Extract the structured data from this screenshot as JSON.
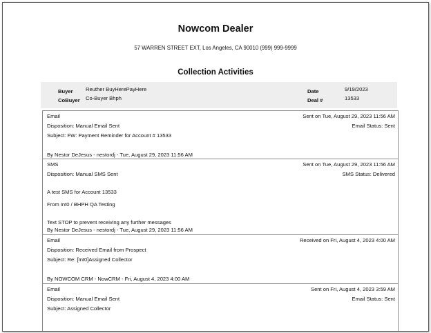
{
  "header": {
    "company_name": "Nowcom Dealer",
    "address": "57 WARREN STREET EXT, Los Angeles, CA 90010  (999) 999-9999",
    "report_title": "Collection Activities"
  },
  "summary": {
    "buyer_label": "Buyer",
    "buyer_value": "Reuther BuyHerePayHere",
    "cobuyer_label": "CoBuyer",
    "cobuyer_value": "Co-Buyer Bhph",
    "date_label": "Date",
    "date_value": "9/19/2023",
    "deal_label": "Deal #",
    "deal_value": "13533"
  },
  "activities": [
    {
      "type": "Email",
      "time": "Sent on Tue, August 29, 2023 11:56 AM",
      "disposition": "Disposition: Manual Email Sent",
      "status": "Email Status: Sent",
      "subject": "Subject: FW: Payment Reminder for Account # 13533",
      "by": "By Nestor DeJesus - nestordj - Tue, August 29, 2023 11:56 AM"
    },
    {
      "type": "SMS",
      "time": "Sent on Tue, August 29, 2023 11:56 AM",
      "disposition": "Disposition: Manual SMS Sent",
      "status": "SMS Status: Delivered",
      "body_1": "A test SMS for Account 13533",
      "body_2": "From Int0 / BHPH QA Testing",
      "body_3": "Text STOP to prevent receiving any further messages",
      "by": "By Nestor DeJesus - nestordj - Tue, August 29, 2023 11:56 AM"
    },
    {
      "type": "Email",
      "time": "Received on Fri, August 4, 2023 4:00 AM",
      "disposition": "Disposition: Received Email from Prospect",
      "subject": "Subject: Re: [Int0]Assigned Collector",
      "by": "By NOWCOM CRM - NowCRM - Fri, August 4, 2023 4:00 AM"
    },
    {
      "type": "Email",
      "time": "Sent on Fri, August 4, 2023 3:59 AM",
      "disposition": "Disposition: Manual Email Sent",
      "status": "Email Status: Sent",
      "subject": "Subject: Assigned Collector"
    }
  ]
}
